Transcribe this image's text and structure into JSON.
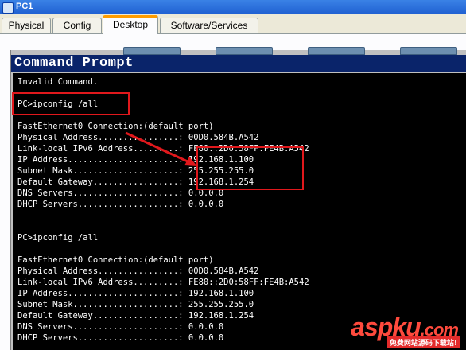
{
  "window": {
    "title": "PC1"
  },
  "tabs": [
    {
      "label": "Physical"
    },
    {
      "label": "Config"
    },
    {
      "label": "Desktop"
    },
    {
      "label": "Software/Services"
    }
  ],
  "active_tab": "Desktop",
  "cmd": {
    "title": "Command Prompt"
  },
  "console_lines": [
    "Invalid Command.",
    "",
    "PC>ipconfig /all",
    "",
    "FastEthernet0 Connection:(default port)",
    "Physical Address................: 00D0.584B.A542",
    "Link-local IPv6 Address.........: FE80::2D0:58FF:FE4B:A542",
    "IP Address......................: 192.168.1.100",
    "Subnet Mask.....................: 255.255.255.0",
    "Default Gateway.................: 192.168.1.254",
    "DNS Servers.....................: 0.0.0.0",
    "DHCP Servers....................: 0.0.0.0",
    "",
    "",
    "PC>ipconfig /all",
    "",
    "FastEthernet0 Connection:(default port)",
    "Physical Address................: 00D0.584B.A542",
    "Link-local IPv6 Address.........: FE80::2D0:58FF:FE4B:A542",
    "IP Address......................: 192.168.1.100",
    "Subnet Mask.....................: 255.255.255.0",
    "Default Gateway.................: 192.168.1.254",
    "DNS Servers.....................: 0.0.0.0",
    "DHCP Servers....................: 0.0.0.0"
  ],
  "watermark": {
    "logo": "aspku",
    "suffix": ".com",
    "sub": "免费网站源码下载站!"
  },
  "colors": {
    "highlight": "#e0181c",
    "cmd_title_bg": "#0a246a",
    "console_bg": "#000000",
    "active_tab_accent": "#ff9c00"
  }
}
